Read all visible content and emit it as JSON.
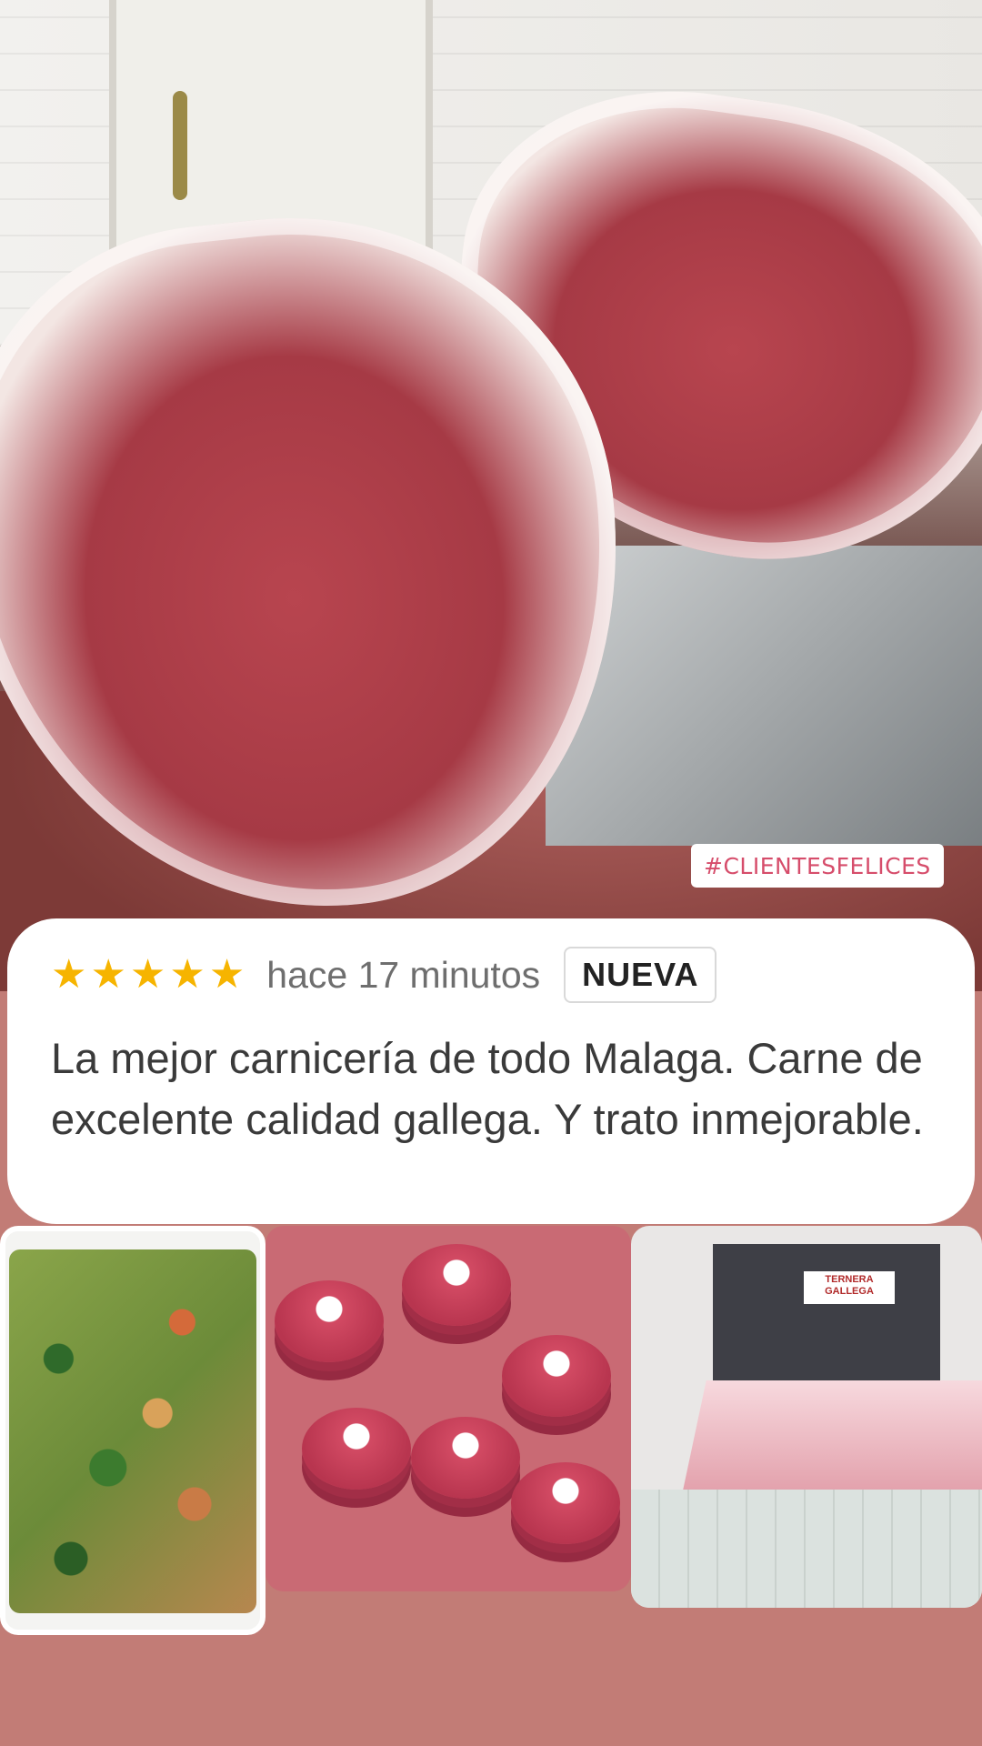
{
  "hashtag": "#CLIENTESFELICES",
  "review": {
    "rating": 5,
    "stars": [
      "★",
      "★",
      "★",
      "★",
      "★"
    ],
    "time": "hace 17 minutos",
    "badge": "NUEVA",
    "text": "La mejor carnicería de todo Malaga. Carne de excelente calidad gallega. Y trato inmejorable."
  },
  "photos": {
    "shop_sign": "TERNERA GALLEGA"
  },
  "colors": {
    "background": "#c27c76",
    "star": "#f6b400",
    "hashtag_text": "#d64d6b"
  }
}
